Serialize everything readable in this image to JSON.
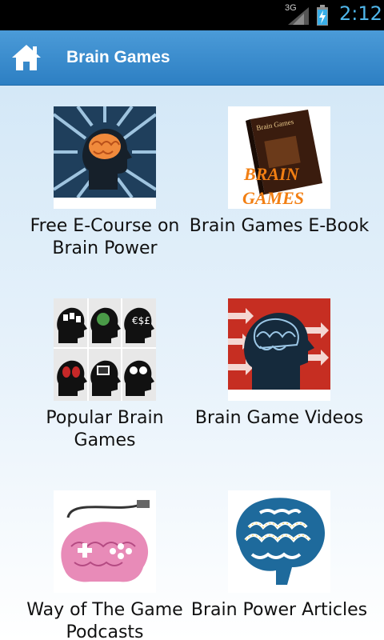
{
  "status_bar": {
    "network": "3G",
    "time": "2:12"
  },
  "header": {
    "title": "Brain Games"
  },
  "tiles": [
    {
      "label": "Free E-Course on Brain Power"
    },
    {
      "label": "Brain Games E-Book",
      "cover_text": "BRAIN GAMES",
      "book_spine_text": "Brain Games"
    },
    {
      "label": "Popular Brain Games"
    },
    {
      "label": "Brain Game Videos"
    },
    {
      "label": "Way of The Game Podcasts"
    },
    {
      "label": "Brain Power Articles"
    }
  ],
  "colors": {
    "action_bar": "#3a8bd0",
    "status_clock": "#4fb6ea",
    "content_bg": "#d4e8f7"
  }
}
